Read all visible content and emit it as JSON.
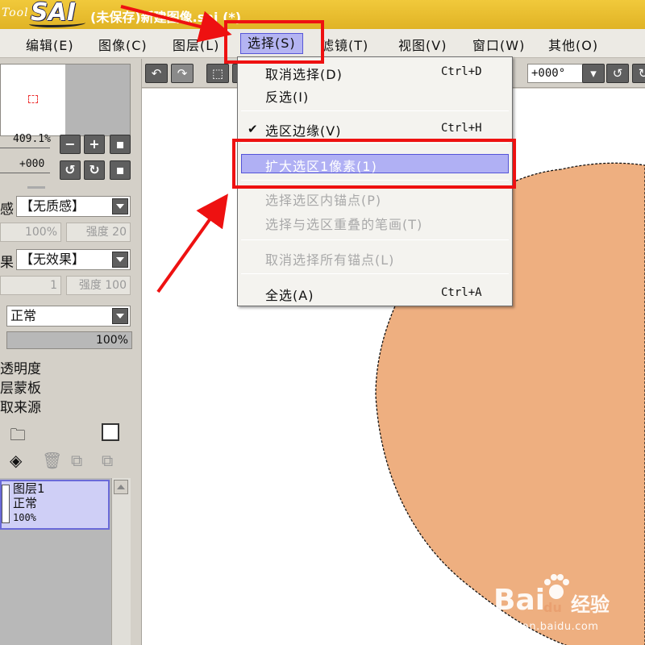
{
  "title_bar": {
    "logo_prefix": "Tool",
    "logo_name": "SAI",
    "document_title": "(未保存)新建图像.sai (*)",
    "background": "#e8bb2e"
  },
  "menubar": {
    "items": [
      {
        "label": "编辑(E)"
      },
      {
        "label": "图像(C)"
      },
      {
        "label": "图层(L)"
      },
      {
        "label": "选择(S)",
        "active": true
      },
      {
        "label": "滤镜(T)"
      },
      {
        "label": "视图(V)"
      },
      {
        "label": "窗口(W)"
      },
      {
        "label": "其他(O)"
      }
    ]
  },
  "selection_menu": {
    "items": [
      {
        "label": "取消选择(D)",
        "shortcut": "Ctrl+D",
        "enabled": true
      },
      {
        "label": "反选(I)",
        "shortcut": "",
        "enabled": true
      },
      {
        "label": "选区边缘(V)",
        "shortcut": "Ctrl+H",
        "enabled": true,
        "checked": true
      },
      {
        "label": "扩大选区1像素(1)",
        "shortcut": "",
        "enabled": true,
        "highlighted": true
      },
      {
        "label": "选择选区内锚点(P)",
        "shortcut": "",
        "enabled": false
      },
      {
        "label": "选择与选区重叠的笔画(T)",
        "shortcut": "",
        "enabled": false
      },
      {
        "label": "取消选择所有锚点(L)",
        "shortcut": "",
        "enabled": false
      },
      {
        "label": "全选(A)",
        "shortcut": "Ctrl+A",
        "enabled": true
      }
    ]
  },
  "navigator": {
    "zoom": "409.1%",
    "rotation": "+000"
  },
  "brush_panel": {
    "texture_label_fragment": "感",
    "texture_value": "【无质感】",
    "texture_percent": "100%",
    "texture_strength": "强度 20",
    "effect_label_fragment": "果",
    "effect_value": "【无效果】",
    "effect_width": "1",
    "effect_strength": "强度 100"
  },
  "layer_panel": {
    "blend_mode": "正常",
    "opacity": "100%",
    "options": [
      "透明度",
      "层蒙板",
      "取来源"
    ],
    "layer": {
      "name": "图层1",
      "mode": "正常",
      "opacity": "100%"
    }
  },
  "canvas_toolbar": {
    "rotation": "+000°"
  },
  "canvas": {
    "shape_color": "#eeaf80"
  },
  "watermark": {
    "brand_latin": "Bai",
    "brand_du": "du",
    "brand_cn": "经验",
    "url": "jingyan.baidu.com"
  }
}
